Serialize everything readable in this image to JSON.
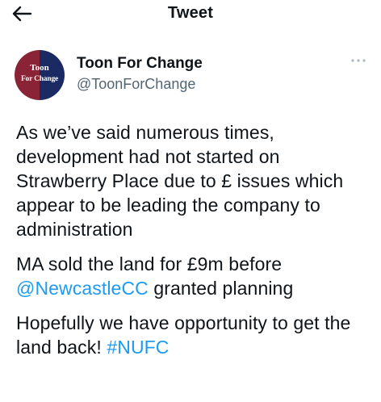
{
  "header": {
    "back_icon": "arrow-left-icon",
    "title": "Tweet"
  },
  "author": {
    "avatar_line1": "Toon",
    "avatar_line2": "For Change",
    "avatar_colors": {
      "left": "#8a2336",
      "right": "#1c2a63"
    },
    "display_name": "Toon For Change",
    "handle": "@ToonForChange",
    "more_icon": "more-horizontal-icon"
  },
  "tweet": {
    "paragraph1": "As we’ve said numerous times, development had not started on Strawberry Place due to £ issues which appear to be leading the company to administration",
    "paragraph2_before": "MA sold the land for £9m before ",
    "paragraph2_mention": "@NewcastleCC",
    "paragraph2_after": " granted planning",
    "paragraph3_before": "Hopefully we have opportunity to get the land back! ",
    "paragraph3_hashtag": "#NUFC"
  },
  "colors": {
    "text": "#0f1419",
    "secondary": "#536471",
    "link": "#1d9bf0"
  }
}
